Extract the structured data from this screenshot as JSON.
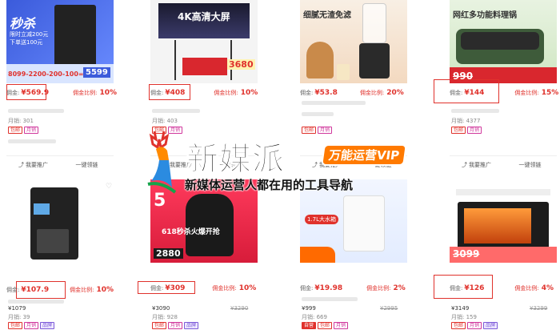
{
  "cards": [
    {
      "commission_label": "佣金:",
      "commission": "¥569.9",
      "rate_label": "佣金比例:",
      "rate": "10%",
      "sales_label": "月销:",
      "sales": "301",
      "tags": [
        "包邮",
        "月销"
      ],
      "thumb_text": [
        "秒杀",
        "限时立减200元",
        "下单送100元",
        "8099-2200-200-100=",
        "5599"
      ]
    },
    {
      "commission_label": "佣金:",
      "commission": "¥408",
      "rate_label": "佣金比例:",
      "rate": "10%",
      "sales_label": "月销:",
      "sales": "403",
      "tags": [
        "包邮",
        "月销"
      ],
      "thumb_text": [
        "4K高清大屏",
        "3680"
      ]
    },
    {
      "commission_label": "佣金:",
      "commission": "¥53.8",
      "rate_label": "佣金比例:",
      "rate": "20%",
      "sales_label": "",
      "sales": "",
      "tags": [
        "包邮",
        "月销"
      ],
      "thumb_text": [
        "细腻无渣免滤"
      ]
    },
    {
      "commission_label": "佣金:",
      "commission": "¥144",
      "rate_label": "佣金比例:",
      "rate": "15%",
      "sales_label": "月销:",
      "sales": "4377",
      "tags": [
        "包邮",
        "月销"
      ],
      "thumb_text": [
        "网红多功能料理锅",
        "990"
      ]
    },
    {
      "commission_label": "佣金:",
      "commission": "¥107.9",
      "rate_label": "佣金比例:",
      "rate": "10%",
      "price": "¥1079",
      "old_price": "",
      "sales_label": "月销:",
      "sales": "39",
      "tags": [
        "包邮",
        "月销",
        "品牌"
      ],
      "thumb_text": []
    },
    {
      "commission_label": "佣金:",
      "commission": "¥309",
      "rate_label": "佣金比例:",
      "rate": "10%",
      "price": "¥3090",
      "old_price": "¥3290",
      "sales_label": "月销:",
      "sales": "928",
      "tags": [
        "包邮",
        "月销",
        "品牌"
      ],
      "thumb_text": [
        "5",
        "618秒杀火爆开抢",
        "2880"
      ]
    },
    {
      "commission_label": "佣金:",
      "commission": "¥19.98",
      "rate_label": "佣金比例:",
      "rate": "2%",
      "price": "¥999",
      "old_price": "¥2995",
      "sales_label": "月销:",
      "sales": "669",
      "tags": [
        "自营",
        "包邮",
        "月销"
      ],
      "thumb_text": [
        "1.7L大水箱"
      ]
    },
    {
      "commission_label": "佣金:",
      "commission": "¥126",
      "rate_label": "佣金比例:",
      "rate": "4%",
      "price": "¥3149",
      "old_price": "¥3299",
      "sales_label": "月销:",
      "sales": "159",
      "tags": [
        "包邮",
        "月销",
        "品牌"
      ],
      "thumb_text": [
        "3099"
      ]
    }
  ],
  "actions": {
    "promote": "我要推广",
    "share": "一键领链"
  },
  "watermark": {
    "title": "新媒派",
    "vip": "万能运营VIP",
    "subtitle": "新媒体运营人都在用的工具导航"
  },
  "colors": {
    "accent": "#e0322c",
    "vip": "#ff7a00"
  }
}
